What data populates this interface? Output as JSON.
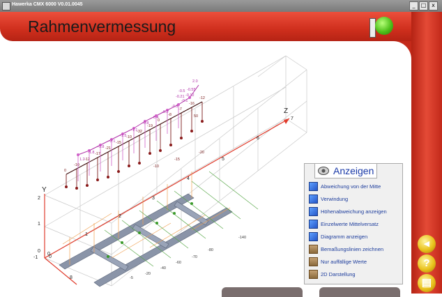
{
  "window": {
    "title": "Hawerka CMX 6000 V0.01.0045",
    "buttons": [
      "_",
      "□",
      "x"
    ]
  },
  "header": {
    "title": "Rahmenvermessung"
  },
  "status": {
    "led_color": "#4ec01a"
  },
  "side_buttons": [
    {
      "icon": "arrow-left-icon",
      "symbol": "◂"
    },
    {
      "icon": "help-icon",
      "symbol": "?"
    },
    {
      "icon": "print-icon",
      "symbol": "▤"
    }
  ],
  "panel": {
    "title": "Anzeigen",
    "options": [
      {
        "label": "Abweichung von der Mitte",
        "icon": "blue"
      },
      {
        "label": "Verwindung",
        "icon": "blue"
      },
      {
        "label": "Höhenabweichung anzeigen",
        "icon": "blue"
      },
      {
        "label": "Einzelwerte Mittelversatz",
        "icon": "blue"
      },
      {
        "label": "Diagramm anzeigen",
        "icon": "blue"
      },
      {
        "label": "Bemaßungslinien zeichnen",
        "icon": "brown"
      },
      {
        "label": "Nur auffällige Werte",
        "icon": "brown"
      },
      {
        "label": "2D Darstellung",
        "icon": "brown"
      }
    ]
  },
  "axes": {
    "y_label": "Y",
    "z_label": "Z",
    "y_ticks": [
      "2",
      "1",
      "0",
      "-1"
    ],
    "z_ticks": [
      "0",
      "1",
      "2",
      "3",
      "4",
      "5",
      "6",
      "7"
    ],
    "x_ticks": [
      "0",
      "8"
    ]
  },
  "height_labels": [
    "0",
    "-10",
    "-12",
    "-17",
    "-21",
    "-15",
    "-10",
    "-32",
    "-19",
    "0",
    "-8",
    "-7",
    "-16",
    "-12",
    "-20",
    "-15",
    "-10",
    "50"
  ],
  "twist_labels": [
    "1.2",
    "-1.8",
    "-1.8",
    "-2.1",
    "-1.5",
    "-1.1",
    "-0.8",
    "-0.4",
    "-0.2",
    "-0.3",
    "-0.1",
    "-0.12",
    "-0.5",
    "-0.55",
    "-0.21",
    "2.0"
  ],
  "offset_labels": [
    "-140",
    "-80",
    "-70",
    "-60",
    "-40",
    "-20",
    "-5"
  ],
  "colors": {
    "header": "#d83a26",
    "accent": "#e9c21c",
    "panel_text": "#1c3c9c"
  }
}
